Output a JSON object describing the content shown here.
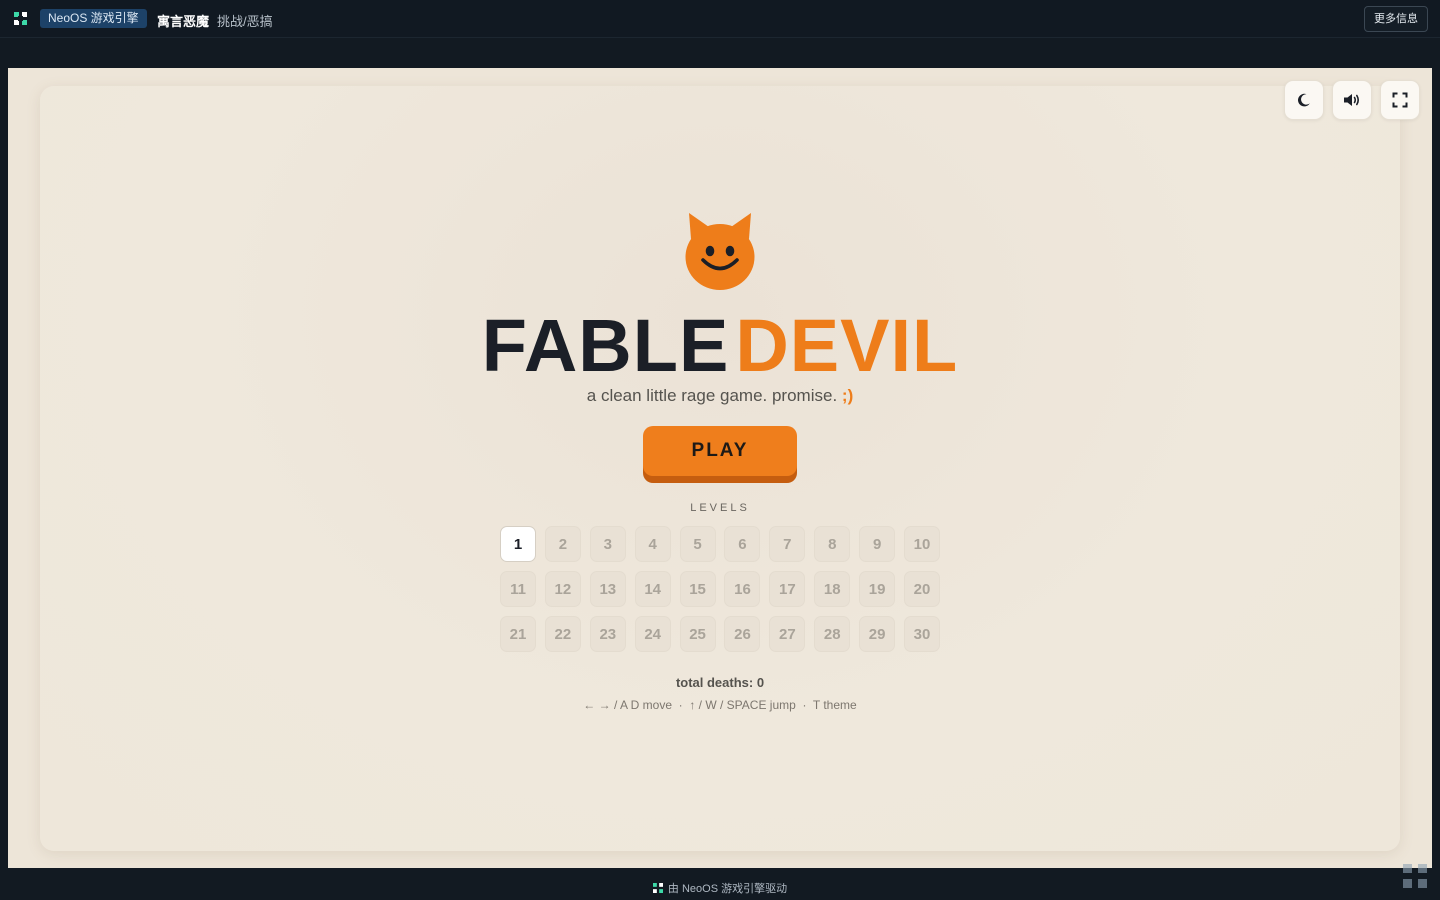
{
  "header": {
    "engine_badge": "NeoOS 游戏引擎",
    "game_title": "寓言恶魔",
    "game_genre": "挑战/恶搞",
    "more_info": "更多信息"
  },
  "controls": {
    "theme_icon": "moon-icon",
    "sound_icon": "speaker-icon",
    "fullscreen_icon": "fullscreen-icon"
  },
  "game": {
    "title_part1": "FABLE",
    "title_part2": "DEVIL",
    "tagline": "a clean little rage game. promise.",
    "tagline_wink": ";)",
    "play_label": "PLAY",
    "levels_label": "LEVELS",
    "levels": [
      "1",
      "2",
      "3",
      "4",
      "5",
      "6",
      "7",
      "8",
      "9",
      "10",
      "11",
      "12",
      "13",
      "14",
      "15",
      "16",
      "17",
      "18",
      "19",
      "20",
      "21",
      "22",
      "23",
      "24",
      "25",
      "26",
      "27",
      "28",
      "29",
      "30"
    ],
    "current_level": "1",
    "deaths_text": "total deaths: 0",
    "controls_hint": "← → / A D move  ·  ↑ / W / SPACE jump  ·  T theme"
  },
  "footer": {
    "text": "由 NeoOS 游戏引擎驱动"
  },
  "colors": {
    "accent": "#ee7d1a",
    "title_dark": "#1b1f27",
    "panel_bg": "#efe8dc",
    "chrome_bg": "#111922"
  }
}
